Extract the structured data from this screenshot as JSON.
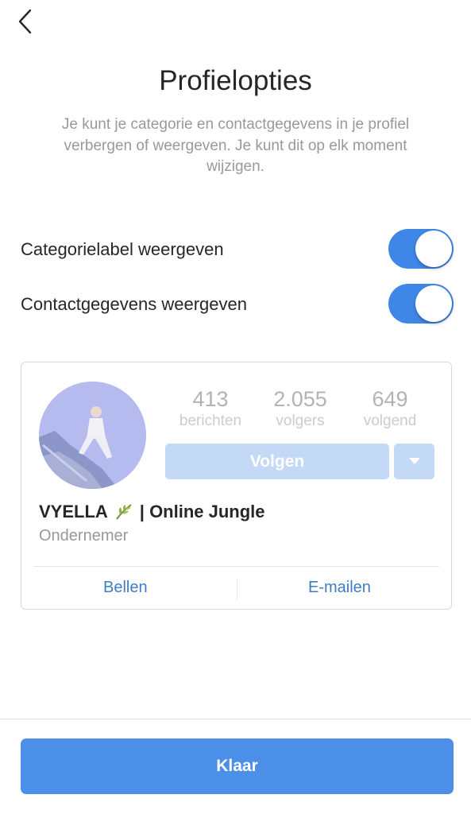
{
  "header": {
    "back_icon": "chevron-left-icon",
    "title": "Profielopties",
    "description": "Je kunt je categorie en contactgegevens in je profiel verbergen of weergeven. Je kunt dit op elk moment wijzigen."
  },
  "options": [
    {
      "label": "Categorielabel weergeven",
      "enabled": true
    },
    {
      "label": "Contactgegevens weergeven",
      "enabled": true
    }
  ],
  "preview": {
    "stats": [
      {
        "value": "413",
        "label": "berichten"
      },
      {
        "value": "2.055",
        "label": "volgers"
      },
      {
        "value": "649",
        "label": "volgend"
      }
    ],
    "follow_label": "Volgen",
    "name_before": "VYELLA",
    "name_emoji_icon": "leaf-icon",
    "name_after": "| Online Jungle",
    "category": "Ondernemer",
    "actions": {
      "call": "Bellen",
      "email": "E-mailen"
    }
  },
  "footer": {
    "done_label": "Klaar"
  },
  "colors": {
    "accent": "#3f87e6",
    "button": "#4b8fe8",
    "link": "#3f7cc4"
  }
}
